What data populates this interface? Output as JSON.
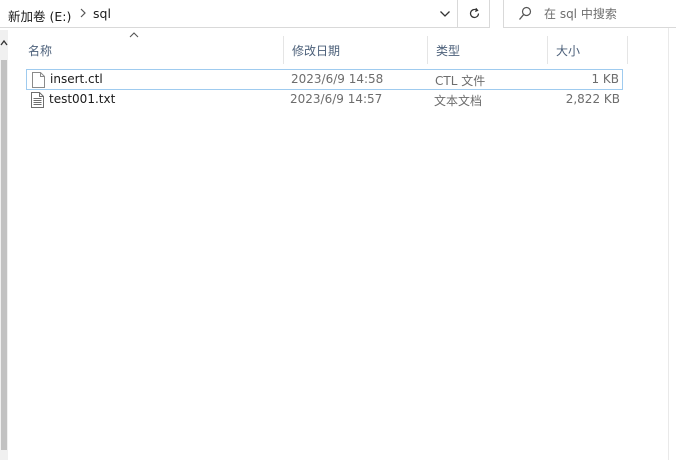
{
  "address_bar": {
    "breadcrumbs": [
      {
        "label": "新加卷 (E:)"
      },
      {
        "label": "sql"
      }
    ]
  },
  "search": {
    "placeholder": "在 sql 中搜索"
  },
  "columns": {
    "name": "名称",
    "date_modified": "修改日期",
    "type": "类型",
    "size": "大小"
  },
  "sort": {
    "column": "name",
    "direction": "ascending"
  },
  "files": [
    {
      "name": "insert.ctl",
      "date_modified": "2023/6/9 14:58",
      "type": "CTL 文件",
      "size": "1 KB",
      "icon": "file-icon",
      "selected": true
    },
    {
      "name": "test001.txt",
      "date_modified": "2023/6/9 14:57",
      "type": "文本文档",
      "size": "2,822 KB",
      "icon": "text-file-icon",
      "selected": false
    }
  ]
}
